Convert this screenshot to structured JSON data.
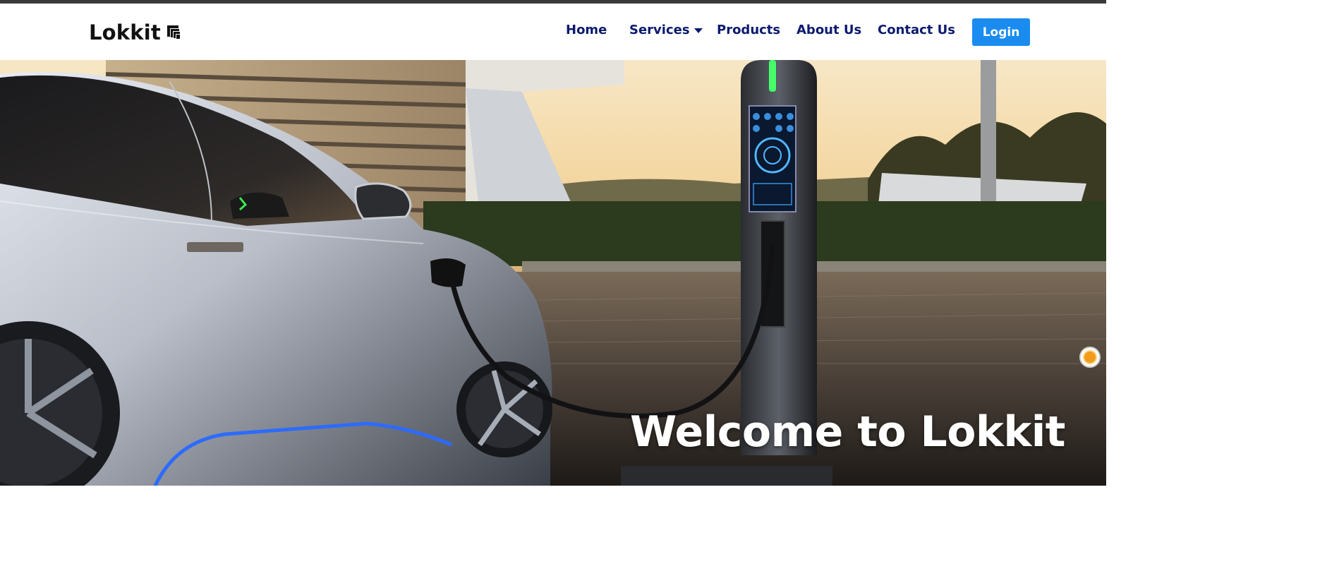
{
  "brand": {
    "name": "Lokkit",
    "logo_icon": "stacked-squares-icon"
  },
  "nav": {
    "items": [
      {
        "label": "Home"
      },
      {
        "label": "Services",
        "has_dropdown": true
      },
      {
        "label": "Products"
      },
      {
        "label": "About Us"
      },
      {
        "label": "Contact Us"
      }
    ],
    "login_label": "Login"
  },
  "hero": {
    "title": "Welcome to Lokkit",
    "image_subject": "electric-car-charging-at-station"
  },
  "theme_toggle": {
    "icon": "sun-icon"
  },
  "colors": {
    "nav_text": "#0b1a6e",
    "login_bg": "#1a8cf0",
    "topbar": "#3a3a3a",
    "hero_title": "#ffffff"
  }
}
